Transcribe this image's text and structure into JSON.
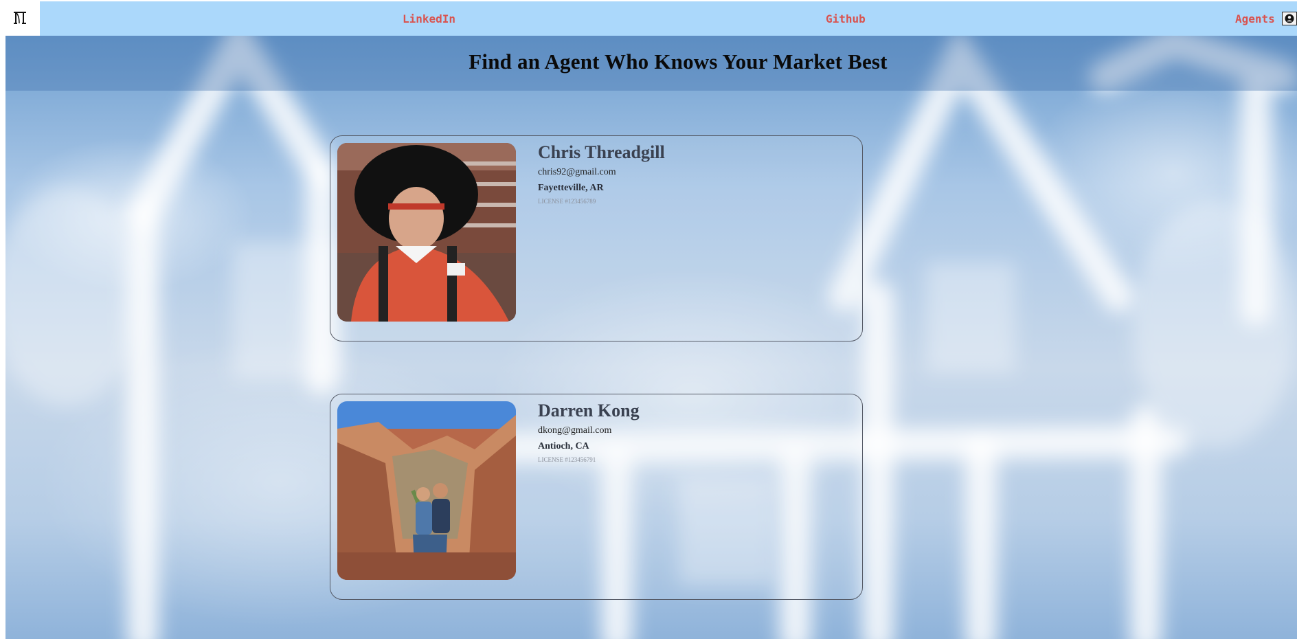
{
  "nav": {
    "links": [
      {
        "label": "LinkedIn"
      },
      {
        "label": "Github"
      },
      {
        "label": "Agents"
      }
    ],
    "logo_icon": "door-logo-icon",
    "user_icon": "user-circle-icon"
  },
  "header": {
    "title": "Find an Agent Who Knows Your Market Best"
  },
  "agents": [
    {
      "name": "Chris Threadgill",
      "email": "chris92@gmail.com",
      "location": "Fayetteville, AR",
      "license": "LICENSE #123456789"
    },
    {
      "name": "Darren Kong",
      "email": "dkong@gmail.com",
      "location": "Antioch, CA",
      "license": "LICENSE #123456791"
    }
  ],
  "colors": {
    "nav_bg": "#abd8fb",
    "nav_link": "#d9534f",
    "card_border": "#555a66"
  }
}
